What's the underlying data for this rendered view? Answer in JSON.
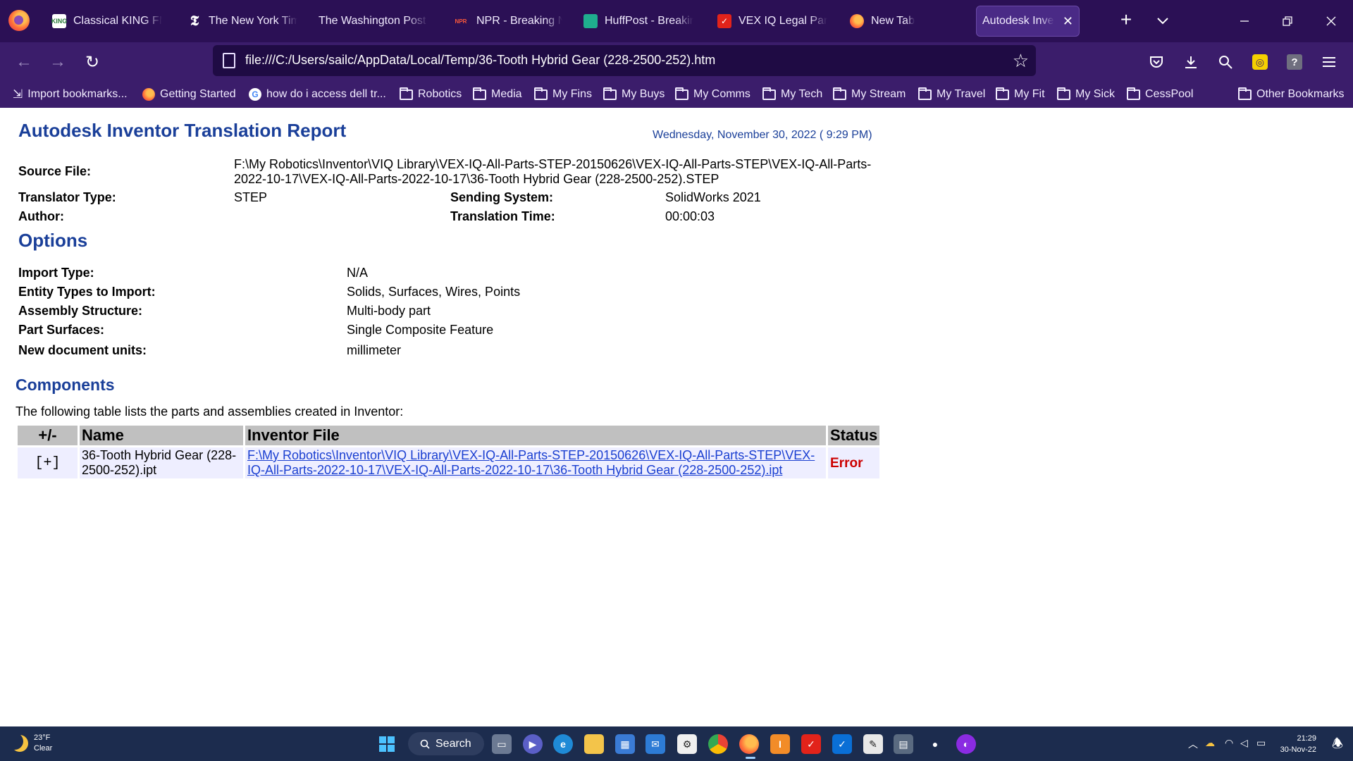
{
  "browser": {
    "tabs": [
      {
        "label": "Classical KING FM",
        "icon": "king-fm-icon"
      },
      {
        "label": "The New York Times",
        "icon": "nyt-icon"
      },
      {
        "label": "The Washington Post -",
        "icon": "wapo-icon"
      },
      {
        "label": "NPR - Breaking News",
        "icon": "npr-icon"
      },
      {
        "label": "HuffPost - Breaking",
        "icon": "huffpost-icon"
      },
      {
        "label": "VEX IQ Legal Parts",
        "icon": "vex-icon"
      },
      {
        "label": "New Tab",
        "icon": "firefox-icon"
      },
      {
        "label": "Autodesk Inventor Translation Report",
        "icon": "none",
        "active": true
      }
    ],
    "url": "file:///C:/Users/sailc/AppData/Local/Temp/36-Tooth Hybrid Gear (228-2500-252).htm",
    "bookmarks": [
      {
        "label": "Import bookmarks...",
        "icon": "import-icon"
      },
      {
        "label": "Getting Started",
        "icon": "firefox-icon"
      },
      {
        "label": "how do i access dell tr...",
        "icon": "google-icon"
      },
      {
        "label": "Robotics",
        "icon": "folder-icon"
      },
      {
        "label": "Media",
        "icon": "folder-icon"
      },
      {
        "label": "My Fins",
        "icon": "folder-icon"
      },
      {
        "label": "My Buys",
        "icon": "folder-icon"
      },
      {
        "label": "My Comms",
        "icon": "folder-icon"
      },
      {
        "label": "My Tech",
        "icon": "folder-icon"
      },
      {
        "label": "My Stream",
        "icon": "folder-icon"
      },
      {
        "label": "My Travel",
        "icon": "folder-icon"
      },
      {
        "label": "My Fit",
        "icon": "folder-icon"
      },
      {
        "label": "My Sick",
        "icon": "folder-icon"
      },
      {
        "label": "CessPool",
        "icon": "folder-icon"
      }
    ],
    "other_bookmarks": "Other Bookmarks",
    "colors": {
      "frame": "#2b1055",
      "toolbar": "#3b1d6b",
      "urlbar": "#1f0b44"
    }
  },
  "report": {
    "title": "Autodesk Inventor Translation Report",
    "date": "Wednesday, November 30, 2022 ( 9:29 PM)",
    "source_file_label": "Source File:",
    "source_file": "F:\\My Robotics\\Inventor\\VIQ Library\\VEX-IQ-All-Parts-STEP-20150626\\VEX-IQ-All-Parts-STEP\\VEX-IQ-All-Parts-2022-10-17\\VEX-IQ-All-Parts-2022-10-17\\36-Tooth Hybrid Gear (228-2500-252).STEP",
    "translator_type_label": "Translator Type:",
    "translator_type": "STEP",
    "sending_system_label": "Sending System:",
    "sending_system": "SolidWorks 2021",
    "author_label": "Author:",
    "author": "",
    "translation_time_label": "Translation Time:",
    "translation_time": "00:00:03",
    "options_heading": "Options",
    "options": [
      {
        "label": "Import Type:",
        "value": "N/A"
      },
      {
        "label": "Entity Types to Import:",
        "value": "Solids, Surfaces, Wires, Points"
      },
      {
        "label": "Assembly Structure:",
        "value": "Multi-body part"
      },
      {
        "label": "Part Surfaces:",
        "value": "Single Composite Feature"
      },
      {
        "label": "New document units:",
        "value": "millimeter"
      }
    ],
    "components_heading": "Components",
    "components_intro": "The following table lists the parts and assemblies created in Inventor:",
    "table": {
      "headers": [
        "+/-",
        "Name",
        "Inventor File",
        "Status"
      ],
      "rows": [
        {
          "expand": "[+]",
          "name": "36-Tooth Hybrid Gear (228-2500-252).ipt",
          "file": "F:\\My Robotics\\Inventor\\VIQ Library\\VEX-IQ-All-Parts-STEP-20150626\\VEX-IQ-All-Parts-STEP\\VEX-IQ-All-Parts-2022-10-17\\VEX-IQ-All-Parts-2022-10-17\\36-Tooth Hybrid Gear (228-2500-252).ipt",
          "status": "Error"
        }
      ]
    },
    "colors": {
      "heading": "#1a3f99",
      "error": "#cc0000",
      "header_bg": "#c0c0c0",
      "row_bg": "#eeeeff"
    }
  },
  "taskbar": {
    "weather_temp": "23°F",
    "weather_desc": "Clear",
    "search_label": "Search",
    "clock_time": "21:29",
    "clock_date": "30-Nov-22"
  }
}
